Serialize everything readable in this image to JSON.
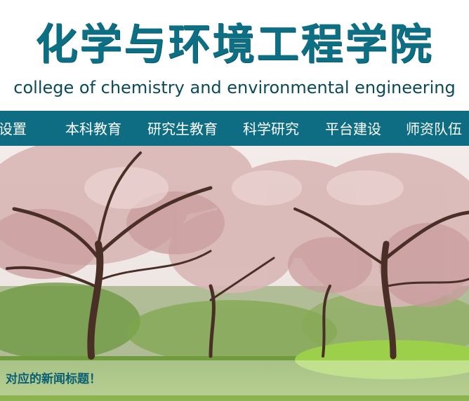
{
  "header": {
    "title_cn": "化学与环境工程学院",
    "title_en": "college of chemistry and environmental engineering"
  },
  "nav": {
    "items": [
      {
        "label": "部设置"
      },
      {
        "label": "本科教育"
      },
      {
        "label": "研究生教育"
      },
      {
        "label": "科学研究"
      },
      {
        "label": "平台建设"
      },
      {
        "label": "师资队伍"
      }
    ]
  },
  "banner": {
    "caption": "对应的新闻标题！"
  },
  "colors": {
    "brand": "#0e6d82",
    "title": "#0c6f83"
  }
}
